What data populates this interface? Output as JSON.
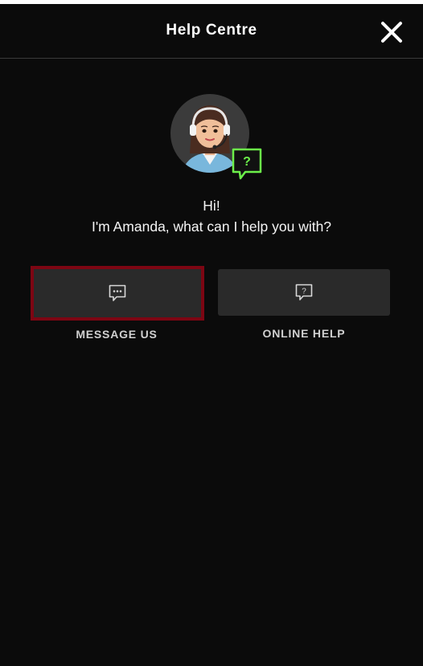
{
  "header": {
    "title": "Help Centre",
    "close_icon": "close-icon"
  },
  "agent": {
    "avatar_icon": "agent-headset-avatar",
    "badge_icon": "question-bubble-icon",
    "badge_glyph": "?",
    "accent_color": "#6cf04a"
  },
  "greeting": {
    "line1": "Hi!",
    "line2": "I'm Amanda, what can I help you with?"
  },
  "actions": [
    {
      "label": "MESSAGE US",
      "icon": "chat-dots-icon",
      "selected": true
    },
    {
      "label": "ONLINE HELP",
      "icon": "chat-question-icon",
      "selected": false,
      "icon_glyph": "?"
    }
  ],
  "colors": {
    "background": "#0b0b0b",
    "button": "#2a2a2a",
    "selected_border": "#7d0613"
  }
}
